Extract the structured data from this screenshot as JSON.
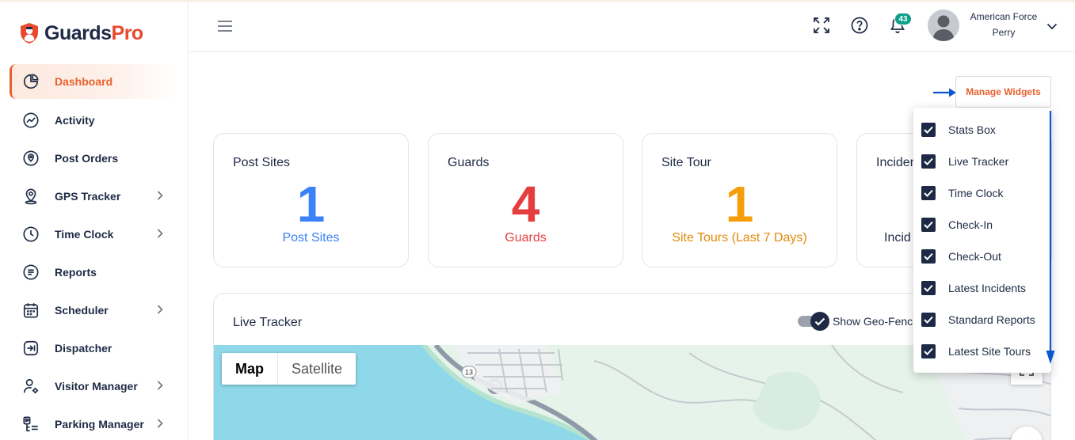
{
  "brand": {
    "name_part1": "Guards",
    "name_part2": "Pro",
    "accent": "#e8492f"
  },
  "sidebar": {
    "items": [
      {
        "label": "Dashboard",
        "icon": "pie-chart-icon",
        "active": true
      },
      {
        "label": "Activity",
        "icon": "activity-chart-icon"
      },
      {
        "label": "Post Orders",
        "icon": "location-pin-icon"
      },
      {
        "label": "GPS Tracker",
        "icon": "map-pin-icon",
        "has_submenu": true
      },
      {
        "label": "Time Clock",
        "icon": "clock-icon",
        "has_submenu": true
      },
      {
        "label": "Reports",
        "icon": "document-icon"
      },
      {
        "label": "Scheduler",
        "icon": "calendar-icon",
        "has_submenu": true
      },
      {
        "label": "Dispatcher",
        "icon": "dispatch-arrow-icon"
      },
      {
        "label": "Visitor Manager",
        "icon": "user-settings-icon",
        "has_submenu": true
      },
      {
        "label": "Parking Manager",
        "icon": "parking-icon",
        "has_submenu": true
      }
    ]
  },
  "header": {
    "notification_count": "43",
    "user_name": "American Force",
    "user_sub": "Perry"
  },
  "widgets": {
    "manage_label": "Manage Widgets",
    "options": [
      {
        "label": "Stats Box",
        "checked": true
      },
      {
        "label": "Live Tracker",
        "checked": true
      },
      {
        "label": "Time Clock",
        "checked": true
      },
      {
        "label": "Check-In",
        "checked": true
      },
      {
        "label": "Check-Out",
        "checked": true
      },
      {
        "label": "Latest Incidents",
        "checked": true
      },
      {
        "label": "Standard Reports",
        "checked": true
      },
      {
        "label": "Latest Site Tours",
        "checked": true
      }
    ]
  },
  "stats": [
    {
      "title": "Post Sites",
      "value": "1",
      "label": "Post Sites",
      "color": "#3b82f6"
    },
    {
      "title": "Guards",
      "value": "4",
      "label": "Guards",
      "color": "#e53e3e"
    },
    {
      "title": "Site Tour",
      "value": "1",
      "label": "Site Tours (Last 7 Days)",
      "color": "#f59e0b"
    },
    {
      "title": "Inciden",
      "value": "",
      "label": "Incid",
      "color": "#1e2a45"
    }
  ],
  "tracker": {
    "title": "Live Tracker",
    "geofence_label": "Show Geo-Fenc",
    "map_label": "Map",
    "satellite_label": "Satellite",
    "road_shield": "13"
  }
}
